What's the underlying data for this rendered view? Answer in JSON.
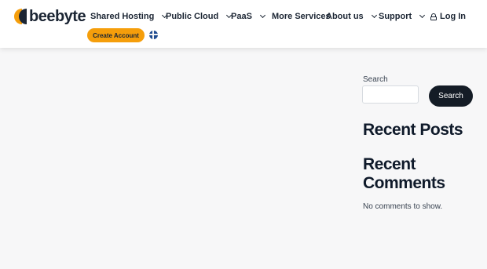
{
  "header": {
    "logo_text": "beebyte",
    "nav": [
      {
        "label": "Shared Hosting"
      },
      {
        "label": "Public Cloud"
      },
      {
        "label": "PaaS"
      },
      {
        "label": "More Services"
      },
      {
        "label": "About us"
      },
      {
        "label": "Support"
      }
    ],
    "login_label": "Log In",
    "create_account_label": "Create Account",
    "language_icon": "swedish-flag-icon"
  },
  "sidebar": {
    "search_label": "Search",
    "search_input_value": "",
    "search_button_label": "Search",
    "recent_posts_heading": "Recent Posts",
    "recent_comments_heading": "Recent Comments",
    "no_comments_text": "No comments to show."
  },
  "colors": {
    "accent": "#f59e0b",
    "dark": "#1b2533",
    "search_button_bg": "#141c26",
    "page_bg": "#f7f7f8"
  }
}
